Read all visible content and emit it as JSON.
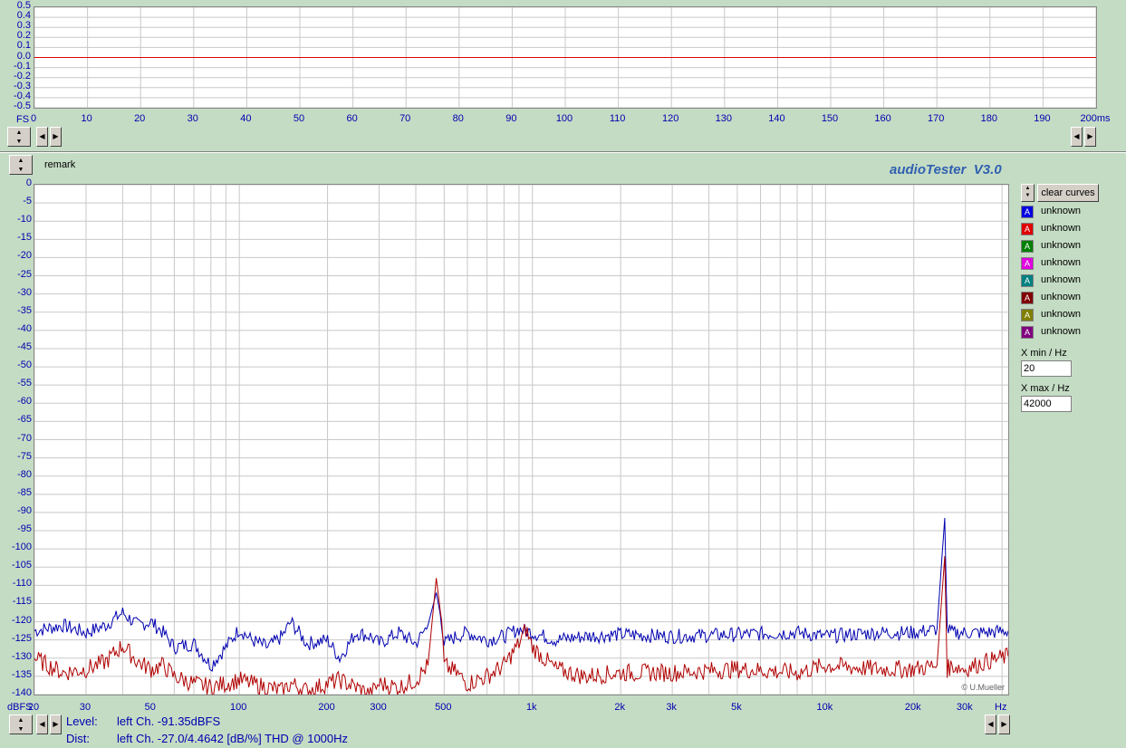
{
  "top_chart": {
    "y_ticks": [
      "0.5",
      "0.4",
      "0.3",
      "0.2",
      "0.1",
      "0.0",
      "-0.1",
      "-0.2",
      "-0.3",
      "-0.4",
      "-0.5"
    ],
    "y_unit": "FS",
    "x_ticks": [
      "0",
      "10",
      "20",
      "30",
      "40",
      "50",
      "60",
      "70",
      "80",
      "90",
      "100",
      "110",
      "120",
      "130",
      "140",
      "150",
      "160",
      "170",
      "180",
      "190",
      "200ms"
    ]
  },
  "remark_label": "remark",
  "app_title": "audioTester  V3.0",
  "clear_curves_label": "clear curves",
  "legend": [
    {
      "label": "unknown",
      "color": "#0000e0"
    },
    {
      "label": "unknown",
      "color": "#e00000"
    },
    {
      "label": "unknown",
      "color": "#008000"
    },
    {
      "label": "unknown",
      "color": "#e000e0"
    },
    {
      "label": "unknown",
      "color": "#008080"
    },
    {
      "label": "unknown",
      "color": "#800000"
    },
    {
      "label": "unknown",
      "color": "#808000"
    },
    {
      "label": "unknown",
      "color": "#800080"
    }
  ],
  "legend_glyph": "A",
  "xmin": {
    "label": "X min / Hz",
    "value": "20"
  },
  "xmax": {
    "label": "X max / Hz",
    "value": "42000"
  },
  "copyright": "© U.Mueller",
  "status": {
    "level_label": "Level:",
    "level_value": "left Ch. -91.35dBFS",
    "dist_label": "Dist:",
    "dist_value": "left Ch. -27.0/4.4642 [dB/%] THD @ 1000Hz"
  },
  "chart_data": [
    {
      "type": "line",
      "x": [
        0,
        200
      ],
      "xlim": [
        0,
        200
      ],
      "ylim": [
        -0.5,
        0.5
      ],
      "series": [
        {
          "values": [
            0.0,
            0.0
          ],
          "color": "#e00000"
        }
      ],
      "grid": true
    },
    {
      "type": "line",
      "xscale": "log",
      "xlim": [
        20,
        42000
      ],
      "ylim": [
        -140,
        0
      ],
      "ylabel": "dBFS",
      "xlabel": "Hz",
      "y_ticks": [
        "0",
        "-5",
        "-10",
        "-15",
        "-20",
        "-25",
        "-30",
        "-35",
        "-40",
        "-45",
        "-50",
        "-55",
        "-60",
        "-65",
        "-70",
        "-75",
        "-80",
        "-85",
        "-90",
        "-95",
        "-100",
        "-105",
        "-110",
        "-115",
        "-120",
        "-125",
        "-130",
        "-135",
        "-140"
      ],
      "x_ticks": [
        {
          "v": 20,
          "label": "20"
        },
        {
          "v": 30,
          "label": "30"
        },
        {
          "v": 50,
          "label": "50"
        },
        {
          "v": 100,
          "label": "100"
        },
        {
          "v": 200,
          "label": "200"
        },
        {
          "v": 300,
          "label": "300"
        },
        {
          "v": 500,
          "label": "500"
        },
        {
          "v": 1000,
          "label": "1k"
        },
        {
          "v": 2000,
          "label": "2k"
        },
        {
          "v": 3000,
          "label": "3k"
        },
        {
          "v": 5000,
          "label": "5k"
        },
        {
          "v": 10000,
          "label": "10k"
        },
        {
          "v": 20000,
          "label": "20k"
        },
        {
          "v": 30000,
          "label": "30k"
        }
      ],
      "grid": true,
      "series": [
        {
          "color": "#0000b0",
          "x": [
            20,
            25,
            30,
            35,
            40,
            45,
            50,
            55,
            60,
            70,
            80,
            90,
            100,
            110,
            125,
            140,
            150,
            170,
            200,
            220,
            250,
            280,
            300,
            350,
            400,
            440,
            470,
            490,
            500,
            550,
            600,
            700,
            800,
            900,
            1000,
            1200,
            1500,
            2000,
            3000,
            5000,
            8000,
            10000,
            15000,
            20000,
            24000,
            25500,
            26000,
            27000,
            30000,
            35000,
            42000
          ],
          "y": [
            -122.5,
            -121,
            -123,
            -121,
            -117.5,
            -121,
            -120,
            -123,
            -127,
            -126,
            -132,
            -127,
            -122,
            -125,
            -127,
            -124,
            -120,
            -126,
            -125,
            -130,
            -123,
            -124,
            -126,
            -123,
            -126,
            -121,
            -112,
            -120,
            -126,
            -124,
            -123,
            -125,
            -124,
            -122,
            -123,
            -125,
            -124,
            -123.5,
            -124,
            -123.5,
            -123,
            -124,
            -123,
            -123,
            -122,
            -91.5,
            -122,
            -123,
            -123,
            -123,
            -122.5
          ]
        },
        {
          "color": "#b00000",
          "x": [
            20,
            25,
            30,
            35,
            40,
            45,
            50,
            55,
            60,
            70,
            80,
            90,
            100,
            110,
            125,
            140,
            150,
            170,
            200,
            220,
            250,
            280,
            300,
            350,
            400,
            440,
            470,
            490,
            500,
            550,
            600,
            700,
            800,
            900,
            950,
            1000,
            1200,
            1500,
            2000,
            3000,
            5000,
            8000,
            10000,
            15000,
            20000,
            24000,
            25500,
            26000,
            27000,
            30000,
            35000,
            42000
          ],
          "y": [
            -130,
            -134,
            -133,
            -131,
            -126.5,
            -131,
            -133,
            -132,
            -135,
            -137,
            -138,
            -137,
            -136,
            -137,
            -138,
            -139,
            -137,
            -139,
            -137,
            -136,
            -138,
            -140,
            -137,
            -138,
            -136,
            -132,
            -108,
            -120,
            -132,
            -134,
            -137,
            -135,
            -132,
            -126,
            -122,
            -127,
            -133,
            -135,
            -134,
            -134,
            -133,
            -134,
            -132,
            -133,
            -133,
            -132,
            -102,
            -133,
            -132,
            -133,
            -131,
            -129.5
          ]
        }
      ]
    }
  ]
}
